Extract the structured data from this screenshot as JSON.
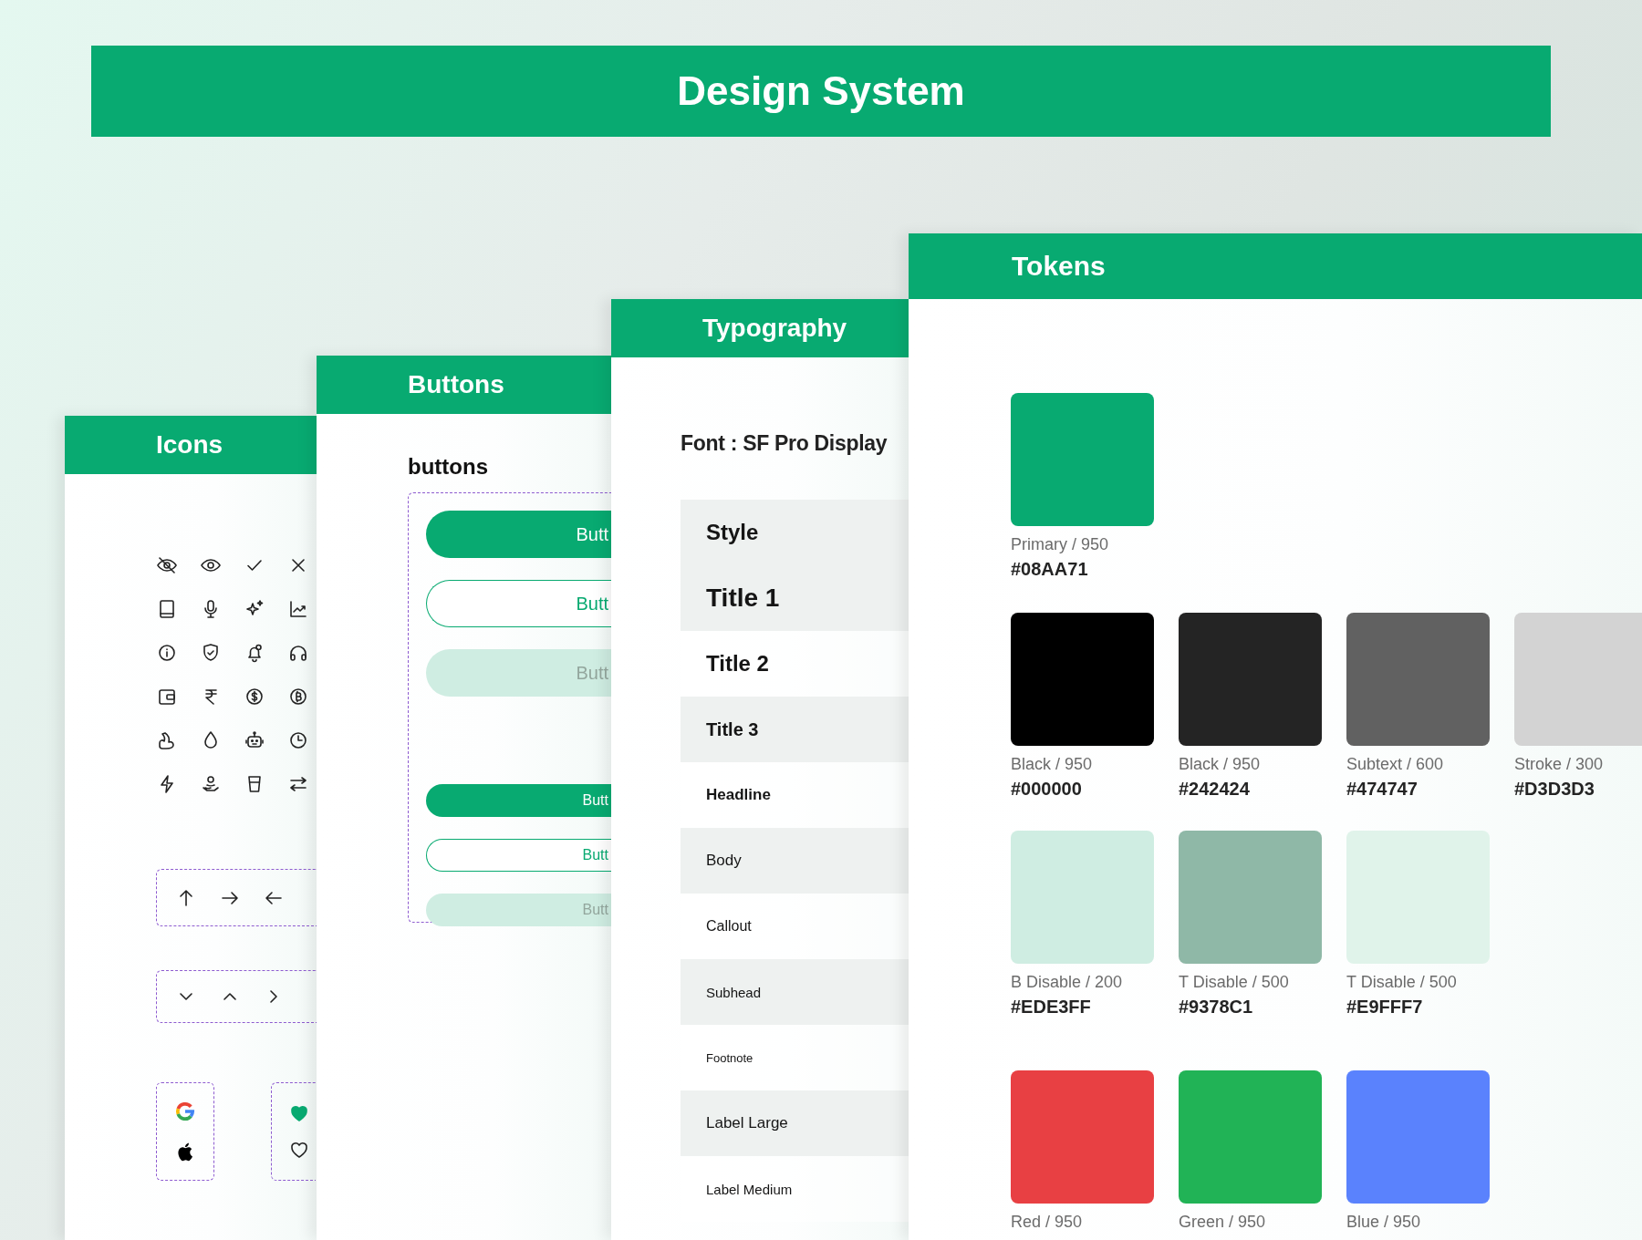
{
  "banner": {
    "title": "Design System"
  },
  "cards": [
    {
      "kind": "icons",
      "title": "Icons"
    },
    {
      "kind": "buttons",
      "title": "Buttons",
      "heading": "buttons",
      "buttons": [
        {
          "label": "Butt",
          "kind": "filled",
          "small": false
        },
        {
          "label": "Butt",
          "kind": "outline",
          "small": false
        },
        {
          "label": "Butt",
          "kind": "disabled",
          "small": false
        },
        {
          "label": "Butt",
          "kind": "filled",
          "small": true
        },
        {
          "label": "Butt",
          "kind": "outline",
          "small": true
        },
        {
          "label": "Butt",
          "kind": "disabled",
          "small": true
        }
      ]
    },
    {
      "kind": "typography",
      "title": "Typography",
      "font": "Font : SF Pro Display",
      "header": "Style",
      "styles": [
        "Title 1",
        "Title 2",
        "Title 3",
        "Headline",
        "Body",
        "Callout",
        "Subhead",
        "Footnote",
        "Label Large",
        "Label Medium"
      ]
    },
    {
      "kind": "tokens",
      "title": "Tokens",
      "rows": [
        [
          {
            "name": "Primary / 950",
            "hex": "#08AA71",
            "color": "#08aa71"
          }
        ],
        [
          {
            "name": "Black / 950",
            "hex": "#000000",
            "color": "#000000"
          },
          {
            "name": "Black / 950",
            "hex": "#242424",
            "color": "#242424"
          },
          {
            "name": "Subtext / 600",
            "hex": "#474747",
            "color": "#616161"
          },
          {
            "name": "Stroke / 300",
            "hex": "#D3D3D3",
            "color": "#d3d3d3"
          }
        ],
        [
          {
            "name": "B Disable / 200",
            "hex": "#EDE3FF",
            "color": "#cfede2"
          },
          {
            "name": "T Disable / 500",
            "hex": "#9378C1",
            "color": "#8fb8a7"
          },
          {
            "name": "T Disable / 500",
            "hex": "#E9FFF7",
            "color": "#e0f3ea"
          }
        ],
        [
          {
            "name": "Red / 950",
            "color": "#e84043"
          },
          {
            "name": "Green / 950",
            "color": "#21b356"
          },
          {
            "name": "Blue / 950",
            "color": "#5a82fd"
          }
        ]
      ]
    }
  ]
}
